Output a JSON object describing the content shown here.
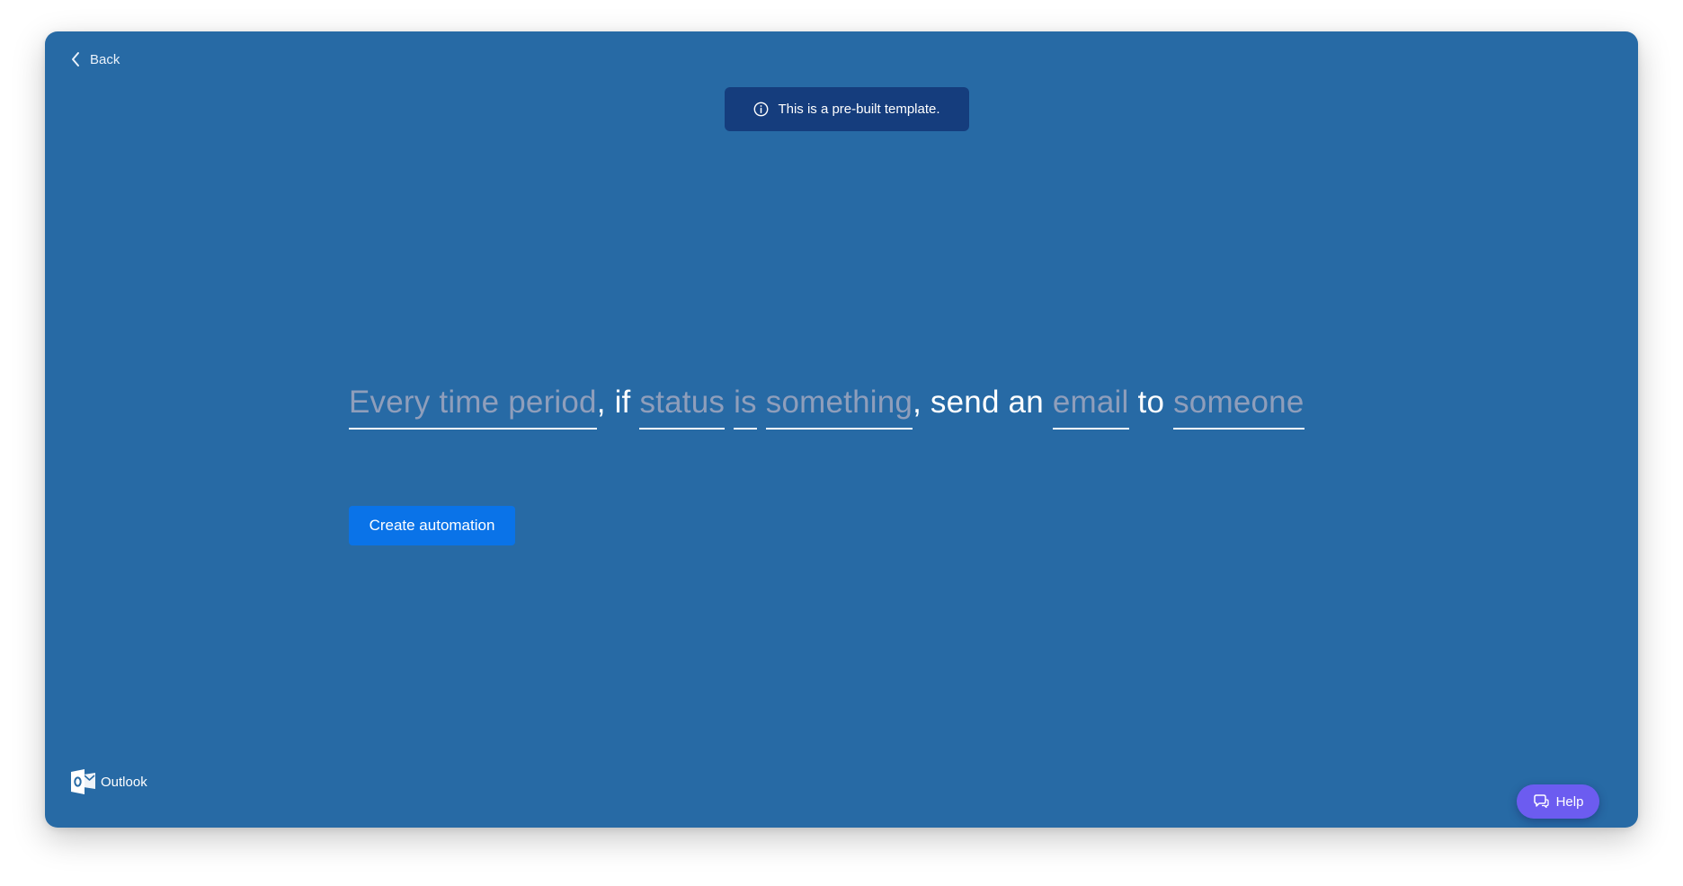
{
  "theme": {
    "panel_bg": "#276aa5",
    "banner_bg": "#153d7d",
    "blank_color": "#8f9ebb",
    "primary": "#0a73e8",
    "help_bg": "#6c5cf0"
  },
  "nav": {
    "back_label": "Back",
    "back_icon": "chevron-left-icon"
  },
  "banner": {
    "icon": "info-icon",
    "text": "This is a pre-built template."
  },
  "recipe": {
    "trigger": "Every time period",
    "sep_if": ", if",
    "condition_field": "status",
    "condition_op": "is",
    "condition_value": "something",
    "sep_action": ", send an",
    "action_type": "email",
    "sep_to": "to",
    "recipient": "someone"
  },
  "actions": {
    "create_label": "Create automation"
  },
  "integration": {
    "logo_icon": "outlook-logo-icon",
    "name": "Outlook"
  },
  "help": {
    "icon": "help-chat-icon",
    "label": "Help"
  }
}
